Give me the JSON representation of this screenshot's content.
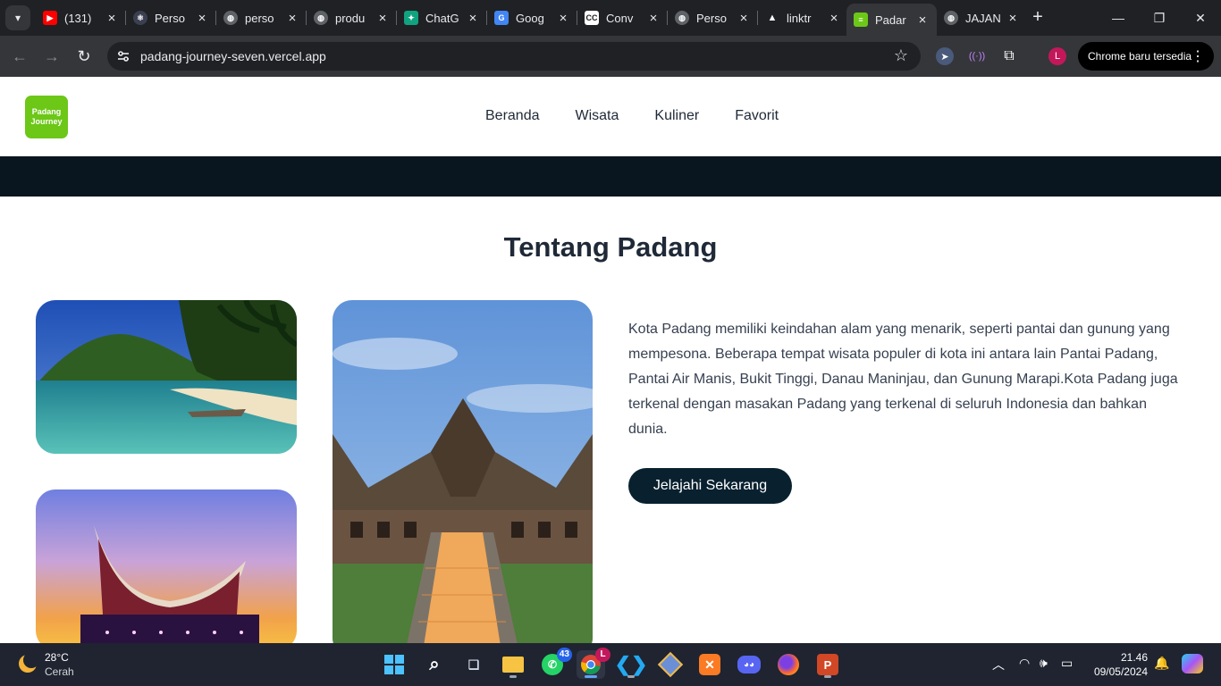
{
  "browser": {
    "tabs": [
      {
        "title": "(131)",
        "favicon_color": "#ff0000",
        "favicon": "youtube-icon"
      },
      {
        "title": "Perso",
        "favicon_color": "#3b3f52",
        "favicon": "react-icon"
      },
      {
        "title": "perso",
        "favicon_color": "#5f6368",
        "favicon": "globe-icon"
      },
      {
        "title": "produ",
        "favicon_color": "#5f6368",
        "favicon": "globe-icon"
      },
      {
        "title": "ChatG",
        "favicon_color": "#10a37f",
        "favicon": "chatgpt-icon"
      },
      {
        "title": "Goog",
        "favicon_color": "#4285f4",
        "favicon": "google-translate-icon"
      },
      {
        "title": "Conv",
        "favicon_color": "#ffffff",
        "favicon": "cc-icon"
      },
      {
        "title": "Perso",
        "favicon_color": "#5f6368",
        "favicon": "globe-icon"
      },
      {
        "title": "linktr",
        "favicon_color": "#ffffff",
        "favicon": "triangle-icon"
      },
      {
        "title": "Padar",
        "favicon_color": "#6cc717",
        "favicon": "padang-journey-icon"
      },
      {
        "title": "JAJAN",
        "favicon_color": "#5f6368",
        "favicon": "globe-icon"
      }
    ],
    "active_tab_index": 9,
    "url": "padang-journey-seven.vercel.app",
    "profile_initial": "L",
    "update_label": "Chrome baru tersedia"
  },
  "site": {
    "logo_line1": "Padang",
    "logo_line2": "Journey",
    "nav": [
      "Beranda",
      "Wisata",
      "Kuliner",
      "Favorit"
    ],
    "section_title": "Tentang Padang",
    "about_text": "Kota Padang memiliki keindahan alam yang menarik, seperti pantai dan gunung yang mempesona. Beberapa tempat wisata populer di kota ini antara lain Pantai Padang, Pantai Air Manis, Bukit Tinggi, Danau Maninjau, dan Gunung Marapi.Kota Padang juga terkenal dengan masakan Padang yang terkenal di seluruh Indonesia dan bahkan dunia.",
    "cta_label": "Jelajahi Sekarang",
    "colors": {
      "brand_green": "#6cc717",
      "dark_navy": "#09212f",
      "heading": "#1f2937"
    }
  },
  "taskbar": {
    "weather_temp": "28°C",
    "weather_condition": "Cerah",
    "whatsapp_badge": "43",
    "chrome_badge": "L",
    "time": "21.46",
    "date": "09/05/2024"
  }
}
